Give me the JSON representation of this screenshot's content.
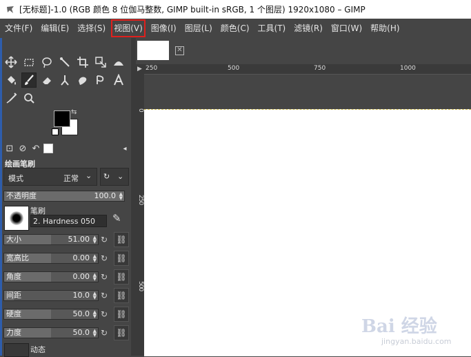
{
  "window": {
    "title": "[无标题]-1.0 (RGB 颜色 8 位伽马整数, GIMP built-in sRGB, 1 个图层) 1920x1080 – GIMP"
  },
  "menu": [
    "文件(F)",
    "编辑(E)",
    "选择(S)",
    "视图(V)",
    "图像(I)",
    "图层(L)",
    "颜色(C)",
    "工具(T)",
    "滤镜(R)",
    "窗口(W)",
    "帮助(H)"
  ],
  "menu_highlight": "视图(V)",
  "tools": [
    {
      "name": "move-icon",
      "glyph": "✥"
    },
    {
      "name": "rect-select-icon",
      "glyph": "▭"
    },
    {
      "name": "free-select-icon",
      "glyph": "◌"
    },
    {
      "name": "fuzzy-select-icon",
      "glyph": "⟋"
    },
    {
      "name": "crop-icon",
      "glyph": "⌗"
    },
    {
      "name": "transform-icon",
      "glyph": "⇲"
    },
    {
      "name": "warp-icon",
      "glyph": "⌒"
    },
    {
      "name": "bucket-fill-icon",
      "glyph": "⬥"
    },
    {
      "name": "paintbrush-icon",
      "glyph": "✎"
    },
    {
      "name": "eraser-icon",
      "glyph": "▱"
    },
    {
      "name": "clone-icon",
      "glyph": "⊥"
    },
    {
      "name": "smudge-icon",
      "glyph": "☛"
    },
    {
      "name": "paths-icon",
      "glyph": "ℨ"
    },
    {
      "name": "text-icon",
      "glyph": "A"
    },
    {
      "name": "color-picker-icon",
      "glyph": "⁄"
    },
    {
      "name": "zoom-icon",
      "glyph": "⚲"
    }
  ],
  "colors": {
    "foreground": "#000000",
    "background": "#ffffff",
    "highlight": "#e0201d"
  },
  "tool_options": {
    "title": "绘画笔刷",
    "mode_label": "模式",
    "mode_value": "正常",
    "opacity": {
      "label": "不透明度",
      "value": "100.0",
      "fraction": 1.0
    },
    "brush": {
      "label": "笔刷",
      "value": "2. Hardness 050"
    },
    "sliders": [
      {
        "label": "大小",
        "value": "51.00",
        "fraction": 0.5
      },
      {
        "label": "宽高比",
        "value": "0.00",
        "fraction": 0.5
      },
      {
        "label": "角度",
        "value": "0.00",
        "fraction": 0.5
      },
      {
        "label": "间距",
        "value": "10.0",
        "fraction": 0.1
      },
      {
        "label": "硬度",
        "value": "50.0",
        "fraction": 0.5
      },
      {
        "label": "力度",
        "value": "50.0",
        "fraction": 0.5
      }
    ],
    "dynamics_label": "动态"
  },
  "ruler": {
    "h_ticks": [
      "250",
      "500",
      "750",
      "1000"
    ],
    "v_ticks": [
      "0",
      "250",
      "500"
    ]
  },
  "watermark": {
    "main": "Bai 经验",
    "sub": "jingyan.baidu.com"
  }
}
